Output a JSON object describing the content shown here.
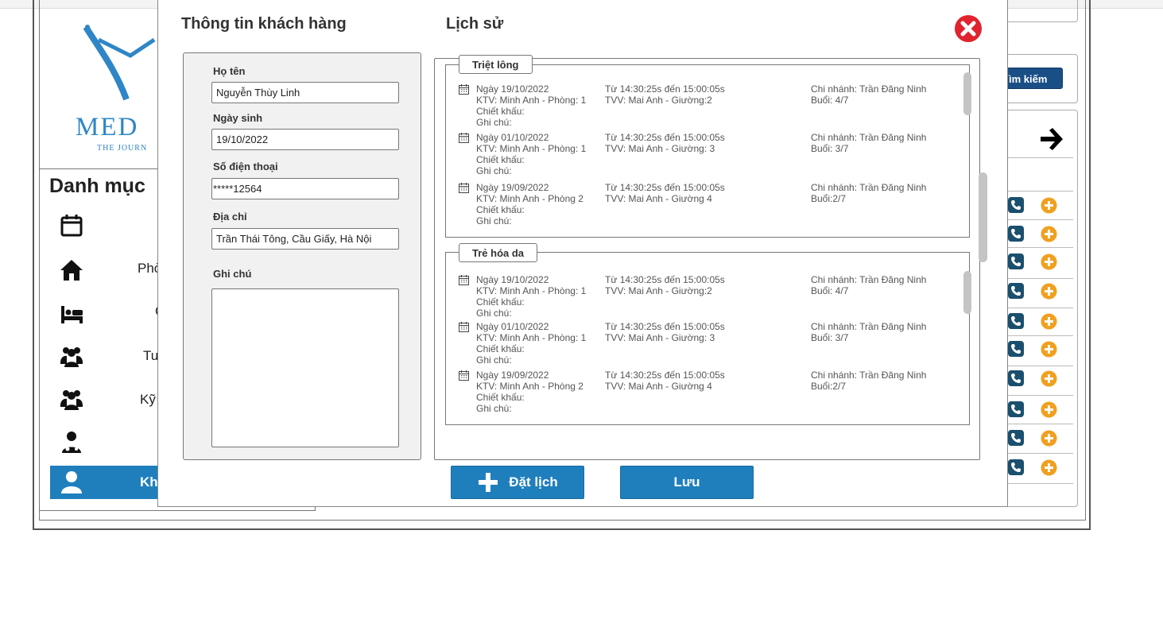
{
  "background": {
    "logo": {
      "text": "MED",
      "tagline": "THE JOURN"
    },
    "sidebar": {
      "heading": "Danh mục",
      "items": [
        {
          "label": "",
          "icon": "calendar-icon"
        },
        {
          "label": "Phò",
          "icon": "home-icon"
        },
        {
          "label": "C",
          "icon": "bed-icon"
        },
        {
          "label": "Tu",
          "icon": "users-icon"
        },
        {
          "label": "Kỹ",
          "icon": "users-icon"
        },
        {
          "label": "",
          "icon": "doctor-icon"
        },
        {
          "label": "Kh",
          "icon": "user-icon",
          "active": true
        }
      ]
    },
    "search_button": "ìm kiếm"
  },
  "modal": {
    "customer_title": "Thông tin khách hàng",
    "history_title": "Lịch sử",
    "form": {
      "name_label": "Họ tên",
      "name_value": "Nguyễn Thùy Linh",
      "dob_label": "Ngày sinh",
      "dob_value": "19/10/2022",
      "phone_label": "Số điện thoại",
      "phone_value": "*****12564",
      "address_label": "Địa chỉ",
      "address_value": "Trần Thái Tông, Cầu Giấy, Hà Nội",
      "note_label": "Ghi chú",
      "note_value": ""
    },
    "groups": [
      {
        "title": "Triệt lông",
        "entries": [
          {
            "date": "Ngày 19/10/2022",
            "ktv": "KTV: Minh Anh - Phòng: 1",
            "discount": "Chiết khấu:",
            "note": "Ghi chú:",
            "time": "Từ 14:30:25s đến 15:00:05s",
            "tvv": "TVV: Mai Anh - Giường:2",
            "branch": "Chi nhánh: Trần Đăng Ninh",
            "session": "Buổi: 4/7"
          },
          {
            "date": "Ngày 01/10/2022",
            "ktv": "KTV: Minh Anh - Phòng: 1",
            "discount": "Chiết khấu:",
            "note": "Ghi chú:",
            "time": "Từ 14:30:25s đến 15:00:05s",
            "tvv": "TVV: Mai Anh - Giường: 3",
            "branch": "Chi nhánh: Trần Đăng Ninh",
            "session": "Buổi: 3/7"
          },
          {
            "date": "Ngày 19/09/2022",
            "ktv": "KTV: Minh Anh - Phòng 2",
            "discount": "Chiết khấu:",
            "note": "Ghi chú:",
            "time": "Từ 14:30:25s đến 15:00:05s",
            "tvv": "TVV: Mai Anh - Giường 4",
            "branch": "Chi nhánh: Trần Đăng Ninh",
            "session": "Buổi:2/7"
          }
        ]
      },
      {
        "title": "Trẻ hóa da",
        "entries": [
          {
            "date": "Ngày 19/10/2022",
            "ktv": "KTV: Minh Anh - Phòng: 1",
            "discount": "Chiết khấu:",
            "note": "Ghi chú:",
            "time": "Từ 14:30:25s đến 15:00:05s",
            "tvv": "TVV: Mai Anh - Giường:2",
            "branch": "Chi nhánh: Trần Đăng Ninh",
            "session": "Buổi: 4/7"
          },
          {
            "date": "Ngày 01/10/2022",
            "ktv": "KTV: Minh Anh - Phòng: 1",
            "discount": "Chiết khấu:",
            "note": "Ghi chú:",
            "time": "Từ 14:30:25s đến 15:00:05s",
            "tvv": "TVV: Mai Anh - Giường: 3",
            "branch": "Chi nhánh: Trần Đăng Ninh",
            "session": "Buổi: 3/7"
          },
          {
            "date": "Ngày 19/09/2022",
            "ktv": "KTV: Minh Anh - Phòng 2",
            "discount": "Chiết khấu:",
            "note": "Ghi chú:",
            "time": "Từ 14:30:25s đến 15:00:05s",
            "tvv": "TVV: Mai Anh - Giường 4",
            "branch": "Chi nhánh: Trần Đăng Ninh",
            "session": "Buổi:2/7"
          }
        ]
      }
    ],
    "book_button": "Đặt lịch",
    "save_button": "Lưu"
  },
  "colors": {
    "primary": "#1f7fbd",
    "close": "#e0232e",
    "accent_orange": "#f0a020",
    "phone_bg": "#1a4f6e"
  }
}
